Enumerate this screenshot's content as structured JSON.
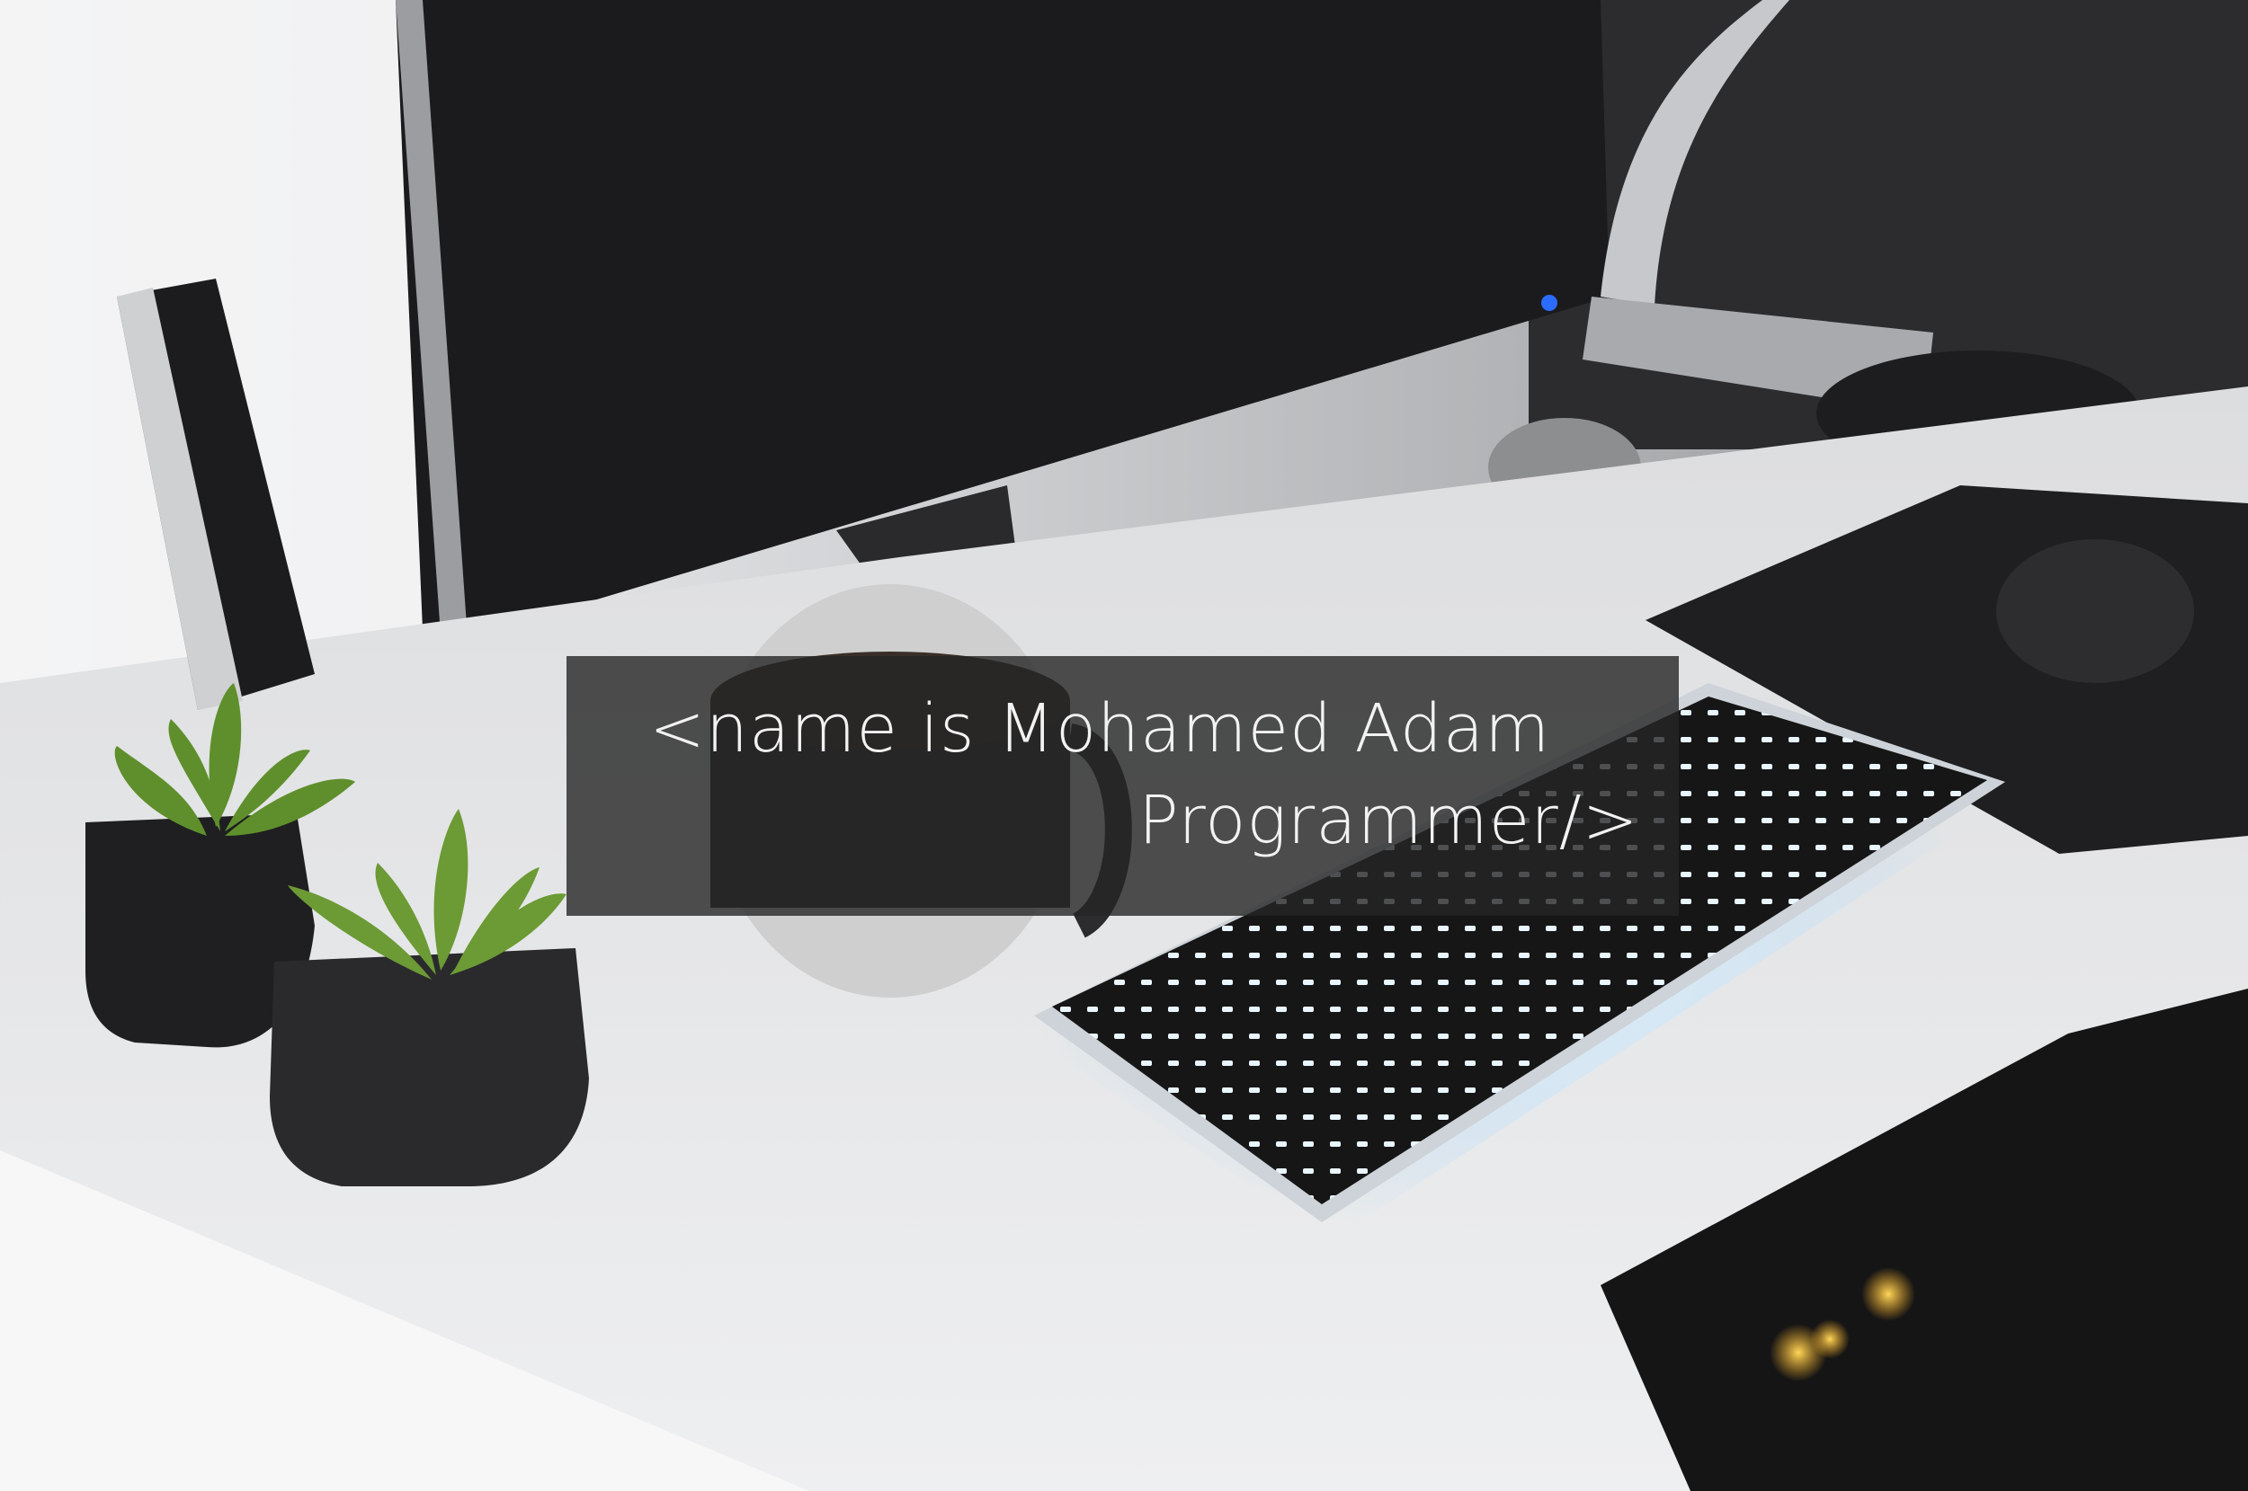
{
  "hero": {
    "line1": "<name is Mohamed Adam",
    "line2": "Programmer/>"
  },
  "colors": {
    "overlay": "#262626",
    "text": "#f2f2f2",
    "desk": "#e6e7e8",
    "monitor": "#1c1c1e",
    "plant": "#5f8f2c",
    "keyboard_glow": "#bfe6ff"
  }
}
